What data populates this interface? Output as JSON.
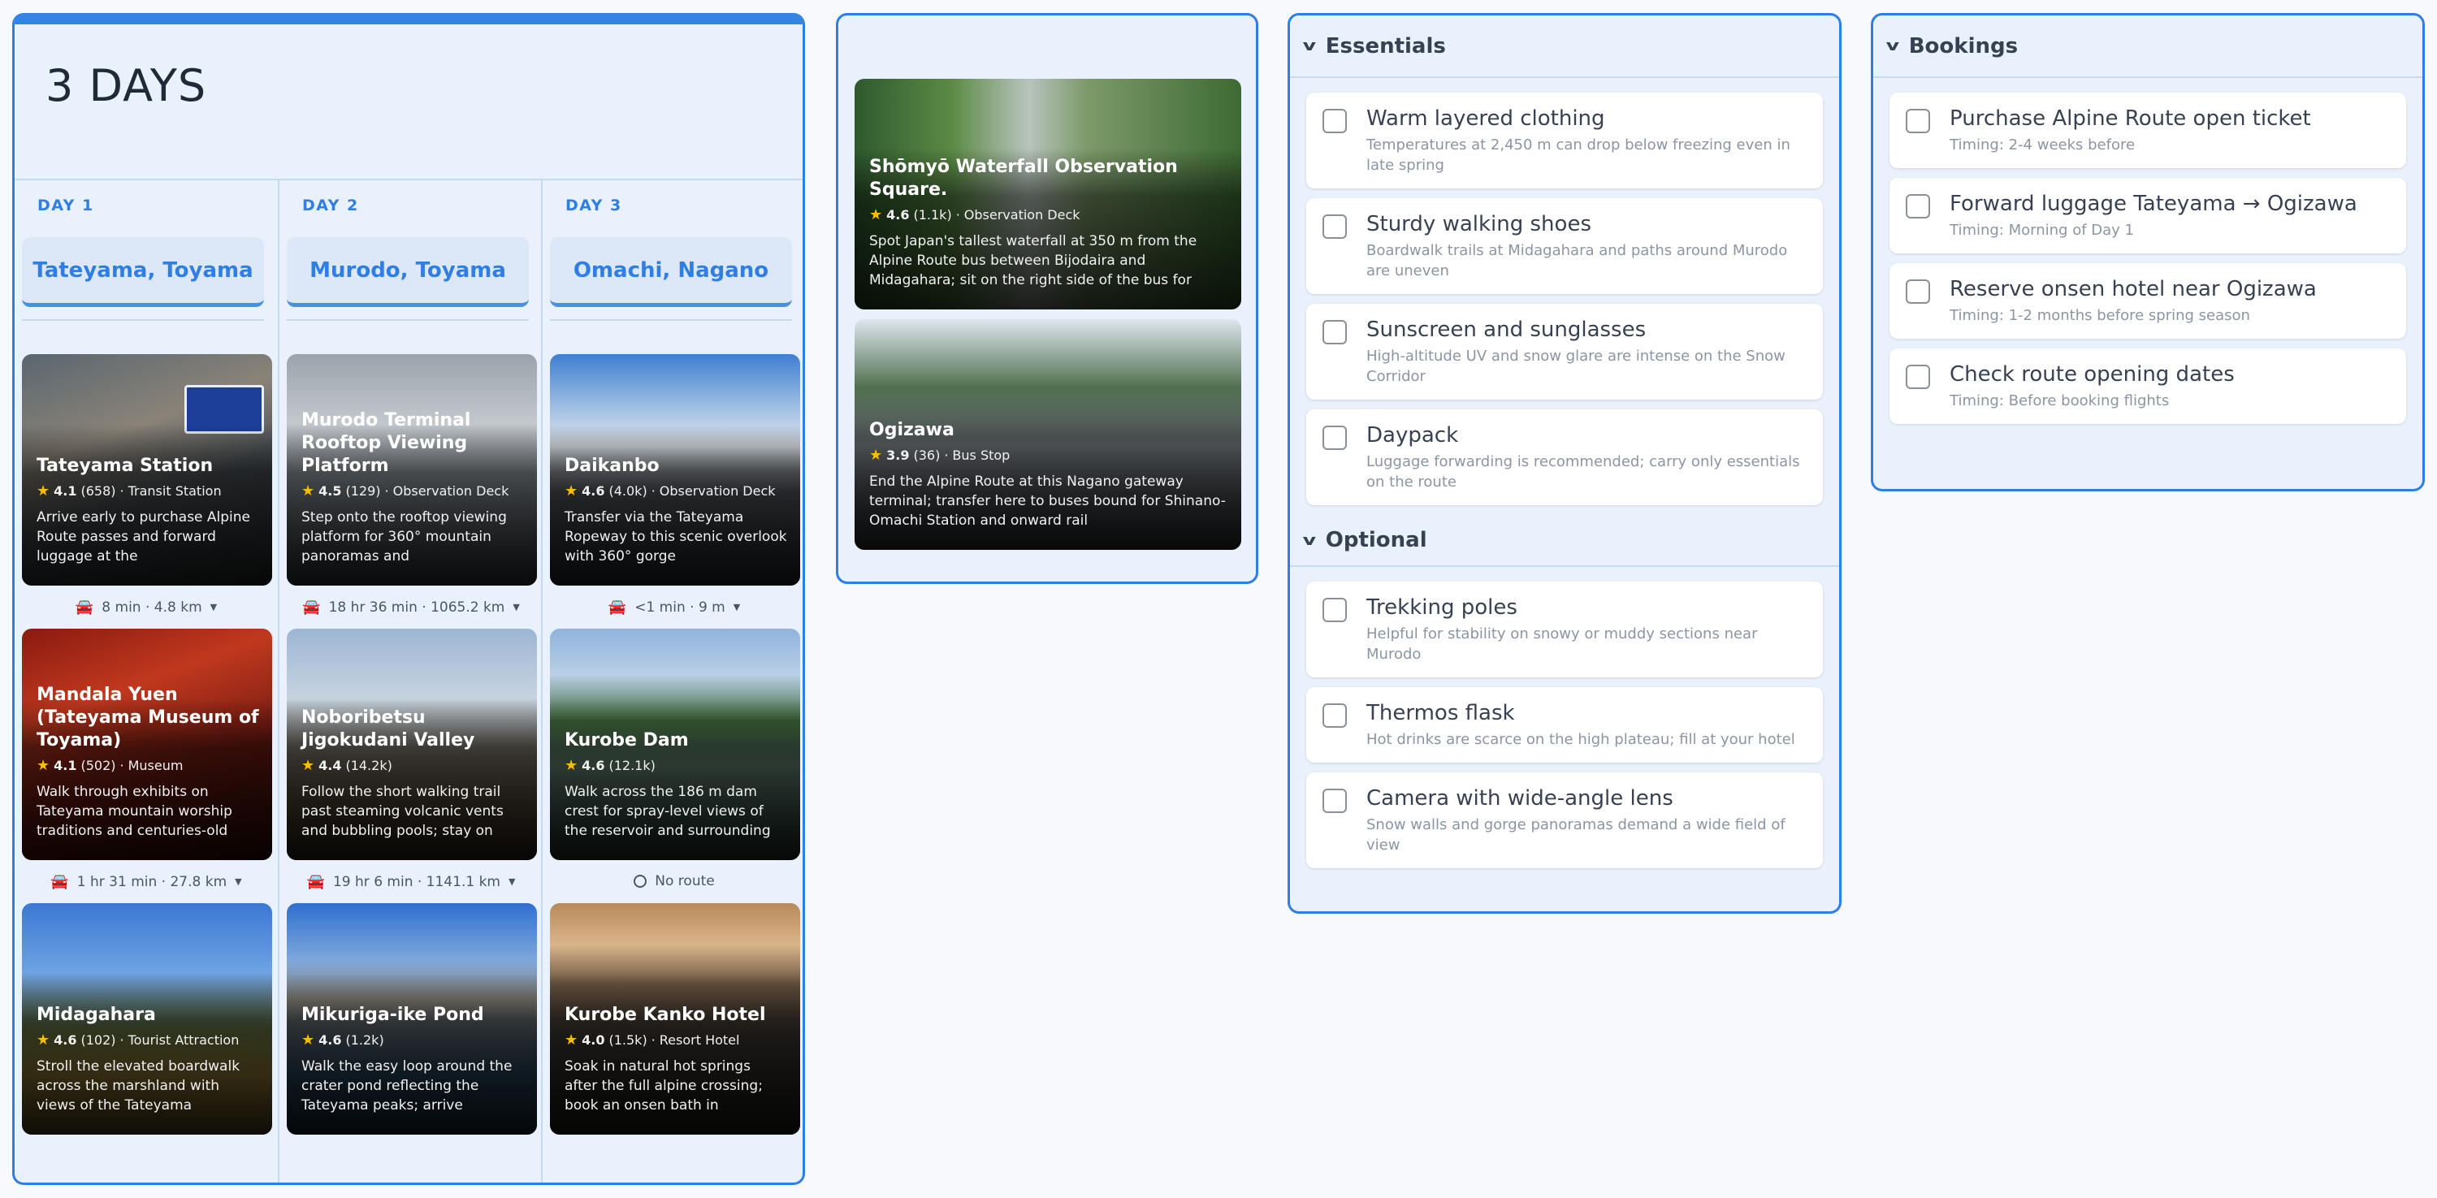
{
  "itinerary": {
    "title": "3 DAYS",
    "days": [
      {
        "label": "DAY 1",
        "location": "Tateyama, Toyama",
        "places": [
          {
            "name": "Tateyama Station",
            "rating": "4.1",
            "reviews": "(658)",
            "category": "Transit Station",
            "desc": "Arrive early to purchase Alpine Route passes and forward luggage at the"
          },
          {
            "name": "Mandala Yuen (Tateyama Museum of Toyama)",
            "rating": "4.1",
            "reviews": "(502)",
            "category": "Museum",
            "desc": "Walk through exhibits on Tateyama mountain worship traditions and centuries-old"
          },
          {
            "name": "Midagahara",
            "rating": "4.6",
            "reviews": "(102)",
            "category": "Tourist Attraction",
            "desc": "Stroll the elevated boardwalk across the marshland with views of the Tateyama"
          }
        ],
        "routes": [
          "8 min · 4.8 km",
          "1 hr 31 min · 27.8 km"
        ]
      },
      {
        "label": "DAY 2",
        "location": "Murodo, Toyama",
        "places": [
          {
            "name": "Murodo Terminal Rooftop Viewing Platform",
            "rating": "4.5",
            "reviews": "(129)",
            "category": "Observation Deck",
            "desc": "Step onto the rooftop viewing platform for 360° mountain panoramas and"
          },
          {
            "name": "Noboribetsu Jigokudani Valley",
            "rating": "4.4",
            "reviews": "(14.2k)",
            "category": "",
            "desc": "Follow the short walking trail past steaming volcanic vents and bubbling pools; stay on"
          },
          {
            "name": "Mikuriga-ike Pond",
            "rating": "4.6",
            "reviews": "(1.2k)",
            "category": "",
            "desc": "Walk the easy loop around the crater pond reflecting the Tateyama peaks; arrive"
          }
        ],
        "routes": [
          "18 hr 36 min · 1065.2 km",
          "19 hr 6 min · 1141.1 km"
        ]
      },
      {
        "label": "DAY 3",
        "location": "Omachi, Nagano",
        "places": [
          {
            "name": "Daikanbo",
            "rating": "4.6",
            "reviews": "(4.0k)",
            "category": "Observation Deck",
            "desc": "Transfer via the Tateyama Ropeway to this scenic overlook with 360° gorge"
          },
          {
            "name": "Kurobe Dam",
            "rating": "4.6",
            "reviews": "(12.1k)",
            "category": "",
            "desc": "Walk across the 186 m dam crest for spray-level views of the reservoir and surrounding"
          },
          {
            "name": "Kurobe Kanko Hotel",
            "rating": "4.0",
            "reviews": "(1.5k)",
            "category": "Resort Hotel",
            "desc": "Soak in natural hot springs after the full alpine crossing; book an onsen bath in"
          }
        ],
        "routes": [
          "<1 min · 9 m",
          "No route"
        ]
      }
    ]
  },
  "extra_places": [
    {
      "name": "Shōmyō Waterfall Observation Square.",
      "rating": "4.6",
      "reviews": "(1.1k)",
      "category": "Observation Deck",
      "desc": "Spot Japan's tallest waterfall at 350 m from the Alpine Route bus between Bijodaira and Midagahara; sit on the right side of the bus for"
    },
    {
      "name": "Ogizawa",
      "rating": "3.9",
      "reviews": "(36)",
      "category": "Bus Stop",
      "desc": "End the Alpine Route at this Nagano gateway terminal; transfer here to buses bound for Shinano-Omachi Station and onward rail"
    }
  ],
  "packing": {
    "essentials_title": "Essentials",
    "essentials": [
      {
        "title": "Warm layered clothing",
        "sub": "Temperatures at 2,450 m can drop below freezing even in late spring"
      },
      {
        "title": "Sturdy walking shoes",
        "sub": "Boardwalk trails at Midagahara and paths around Murodo are uneven"
      },
      {
        "title": "Sunscreen and sunglasses",
        "sub": "High-altitude UV and snow glare are intense on the Snow Corridor"
      },
      {
        "title": "Daypack",
        "sub": "Luggage forwarding is recommended; carry only essentials on the route"
      }
    ],
    "optional_title": "Optional",
    "optional": [
      {
        "title": "Trekking poles",
        "sub": "Helpful for stability on snowy or muddy sections near Murodo"
      },
      {
        "title": "Thermos flask",
        "sub": "Hot drinks are scarce on the high plateau; fill at your hotel"
      },
      {
        "title": "Camera with wide-angle lens",
        "sub": "Snow walls and gorge panoramas demand a wide field of view"
      }
    ]
  },
  "bookings": {
    "title": "Bookings",
    "items": [
      {
        "title": "Purchase Alpine Route open ticket",
        "sub": "Timing: 2-4 weeks before"
      },
      {
        "title": "Forward luggage Tateyama → Ogizawa",
        "sub": "Timing: Morning of Day 1"
      },
      {
        "title": "Reserve onsen hotel near Ogizawa",
        "sub": "Timing: 1-2 months before spring season"
      },
      {
        "title": "Check route opening dates",
        "sub": "Timing: Before booking flights"
      }
    ]
  },
  "colors": {
    "accent": "#2f7ee3",
    "panel_bg": "#e9f1fc",
    "star": "#fbbc04"
  },
  "icons": {
    "chevron": "chevron-down-icon",
    "checkbox": "checkbox-icon",
    "car": "car-icon",
    "no_route": "no-route-icon",
    "star": "star-icon"
  }
}
